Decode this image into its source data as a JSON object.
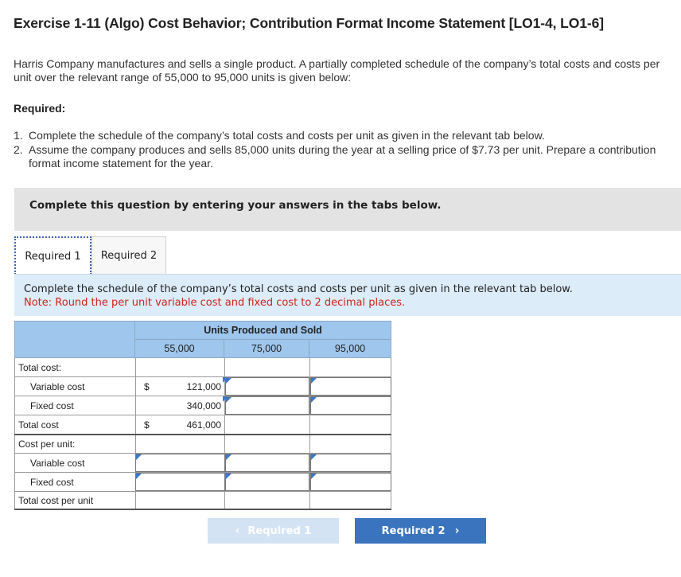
{
  "title": "Exercise 1-11 (Algo) Cost Behavior; Contribution Format Income Statement [LO1-4, LO1-6]",
  "intro": "Harris Company manufactures and sells a single product. A partially completed schedule of the company’s total costs and costs per unit over the relevant range of 55,000 to 95,000 units is given below:",
  "required_heading": "Required:",
  "requirements": [
    {
      "num": "1.",
      "text": "Complete the schedule of the company’s total costs and costs per unit as given in the relevant tab below."
    },
    {
      "num": "2.",
      "text": "Assume the company produces and sells 85,000 units during the year at a selling price of $7.73 per unit. Prepare a contribution format income statement for the year."
    }
  ],
  "instruction_bar": "Complete this question by entering your answers in the tabs below.",
  "tabs": [
    {
      "label": "Required 1",
      "active": true
    },
    {
      "label": "Required 2",
      "active": false
    }
  ],
  "panel": {
    "line1": "Complete the schedule of the company’s total costs and costs per unit as given in the relevant tab below.",
    "note": "Note: Round the per unit variable cost and fixed cost to 2 decimal places."
  },
  "schedule": {
    "group_header": "Units Produced and Sold",
    "columns": [
      "55,000",
      "75,000",
      "95,000"
    ],
    "rows": {
      "total_cost_heading": "Total cost:",
      "variable_cost": "Variable cost",
      "fixed_cost": "Fixed cost",
      "total_cost": "Total cost",
      "cost_per_unit_heading": "Cost per unit:",
      "unit_variable_cost": "Variable cost",
      "unit_fixed_cost": "Fixed cost",
      "total_cost_per_unit": "Total cost per unit"
    },
    "values": {
      "dollar_sign": "$",
      "variable_cost_55000": "121,000",
      "fixed_cost_55000": "340,000",
      "total_cost_55000": "461,000"
    }
  },
  "nav": {
    "prev_label": "Required 1",
    "next_label": "Required 2",
    "prev_icon": "chevron-left-icon",
    "next_icon": "chevron-right-icon"
  },
  "colors": {
    "header_blue": "#9fc6ec",
    "panel_blue": "#dcecf8",
    "note_red": "#d0241b",
    "next_button": "#3a74be",
    "prev_button_disabled": "#d4e3f4"
  }
}
